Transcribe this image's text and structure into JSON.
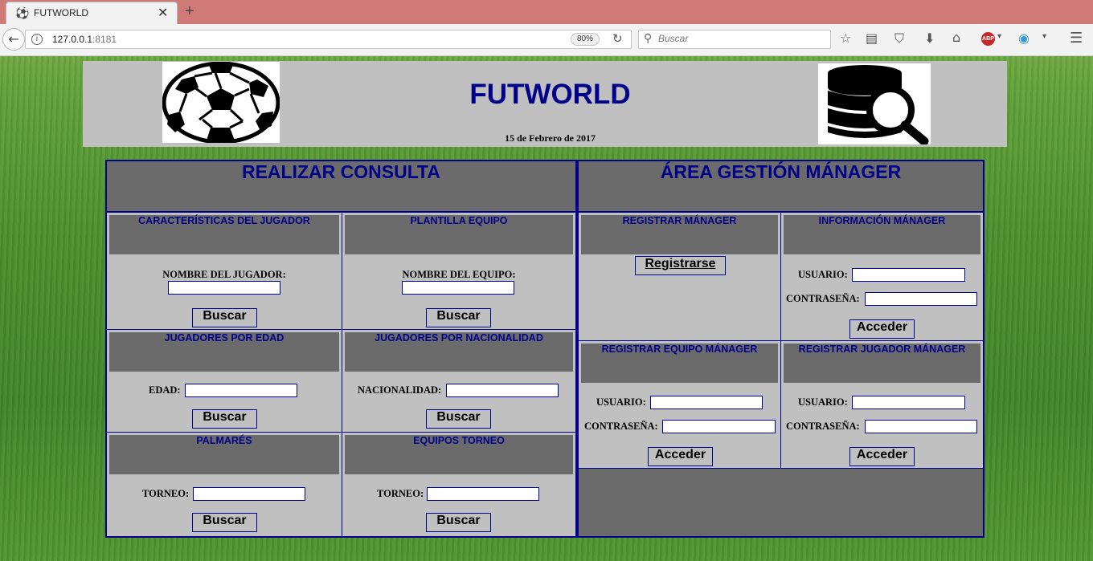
{
  "browser": {
    "tab_title": "FUTWORLD",
    "url_host": "127.0.0.1",
    "url_port": ":8181",
    "zoom": "80%",
    "search_placeholder": "Buscar",
    "new_tab": "+",
    "close": "✕",
    "adblock_label": "ABP"
  },
  "header": {
    "title": "FUTWORLD",
    "date": "15 de Febrero de 2017"
  },
  "consulta": {
    "title": "REALIZAR CONSULTA",
    "cells": [
      {
        "head": "CARACTERÍSTICAS DEL JUGADOR",
        "label": "NOMBRE DEL JUGADOR:",
        "button": "Buscar"
      },
      {
        "head": "PLANTILLA EQUIPO",
        "label": "NOMBRE DEL EQUIPO:",
        "button": "Buscar"
      },
      {
        "head": "JUGADORES POR EDAD",
        "label": "EDAD:",
        "button": "Buscar"
      },
      {
        "head": "JUGADORES POR NACIONALIDAD",
        "label": "NACIONALIDAD:",
        "button": "Buscar"
      },
      {
        "head": "PALMARÉS",
        "label": "TORNEO:",
        "button": "Buscar"
      },
      {
        "head": "EQUIPOS TORNEO",
        "label": "TORNEO:",
        "button": "Buscar"
      }
    ]
  },
  "gestion": {
    "title": "ÁREA GESTIÓN MÁNAGER",
    "registrar": {
      "head": "REGISTRAR MÁNAGER",
      "button": "Registrarse"
    },
    "informacion": {
      "head": "INFORMACIÓN MÁNAGER",
      "user_label": "USUARIO:",
      "pass_label": "CONTRASEÑA:",
      "button": "Acceder"
    },
    "equipo": {
      "head": "REGISTRAR EQUIPO MÁNAGER",
      "user_label": "USUARIO:",
      "pass_label": "CONTRASEÑA:",
      "button": "Acceder"
    },
    "jugador": {
      "head": "REGISTRAR JUGADOR MÁNAGER",
      "user_label": "USUARIO:",
      "pass_label": "CONTRASEÑA:",
      "button": "Acceder"
    }
  },
  "colors": {
    "accent": "#00008b",
    "panel": "#c0c0c0",
    "header_cell": "#6b6b6b",
    "tabbar": "#d07a78"
  },
  "icons": [
    "soccer-ball-icon",
    "database-search-icon",
    "back-arrow-icon",
    "info-icon",
    "reload-icon",
    "search-icon",
    "bookmark-star-icon",
    "reading-list-icon",
    "pocket-icon",
    "download-icon",
    "home-icon",
    "adblock-icon",
    "menu-icon"
  ]
}
